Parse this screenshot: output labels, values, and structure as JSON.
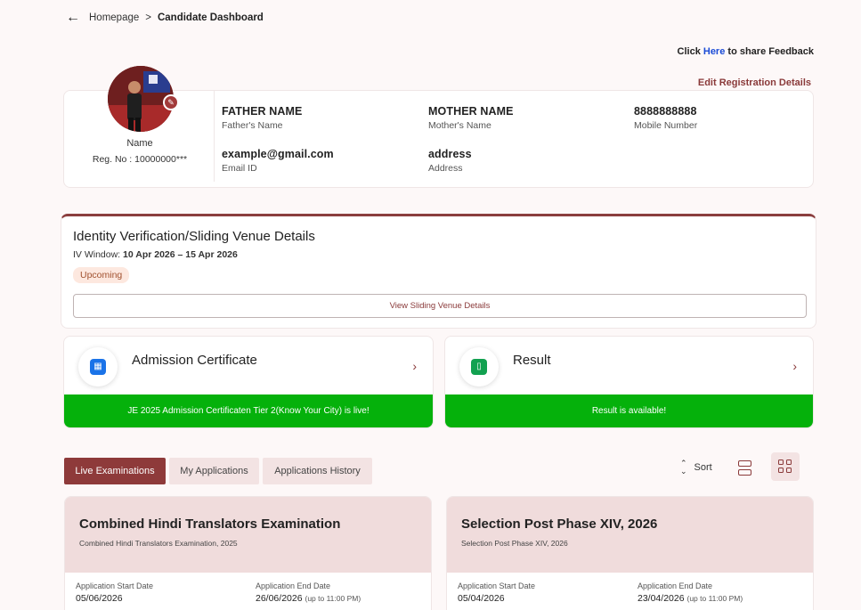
{
  "breadcrumb": {
    "back_icon": "arrow-left-icon",
    "home": "Homepage",
    "separator": ">",
    "current": "Candidate Dashboard"
  },
  "feedback": {
    "prefix": "Click",
    "link": "Here",
    "suffix": "to share Feedback"
  },
  "edit_registration": "Edit Registration Details",
  "profile": {
    "name": "Name",
    "reg_no": "Reg. No : 10000000***",
    "fields": [
      {
        "value": "FATHER NAME",
        "label": "Father's Name"
      },
      {
        "value": "MOTHER NAME",
        "label": "Mother's Name"
      },
      {
        "value": "8888888888",
        "label": "Mobile Number"
      },
      {
        "value": "example@gmail.com",
        "label": "Email ID"
      },
      {
        "value": "address",
        "label": "Address"
      }
    ]
  },
  "iv": {
    "title": "Identity Verification/Sliding Venue Details",
    "window_label": "IV Window:",
    "window_value": "10 Apr 2026 – 15 Apr 2026",
    "status": "Upcoming",
    "button": "View Sliding Venue Details"
  },
  "tiles": [
    {
      "title": "Admission Certificate",
      "icon": "id-card-icon",
      "banner": "JE 2025 Admission Certificaten Tier 2(Know Your City) is live!",
      "icon_color": "#1a73e8"
    },
    {
      "title": "Result",
      "icon": "bar-chart-icon",
      "banner": "Result is available!",
      "icon_color": "#12a150"
    }
  ],
  "tabs": [
    "Live Examinations",
    "My Applications",
    "Applications History"
  ],
  "sort_label": "Sort",
  "exams": [
    {
      "title": "Combined Hindi Translators Examination",
      "subtitle": "Combined Hindi Translators Examination, 2025",
      "start_label": "Application Start Date",
      "start_value": "05/06/2026",
      "end_label": "Application End Date",
      "end_value": "26/06/2026",
      "end_note": "(up to 11:00 PM)"
    },
    {
      "title": "Selection Post Phase XIV, 2026",
      "subtitle": "Selection Post Phase XIV, 2026",
      "start_label": "Application Start Date",
      "start_value": "05/04/2026",
      "end_label": "Application End Date",
      "end_value": "23/04/2026",
      "end_note": "(up to 11:00 PM)"
    }
  ],
  "colors": {
    "brand": "#8e3a3a",
    "success": "#05b10b",
    "tab_inactive": "#f3e3e3",
    "card_head": "#f0dcdc"
  }
}
